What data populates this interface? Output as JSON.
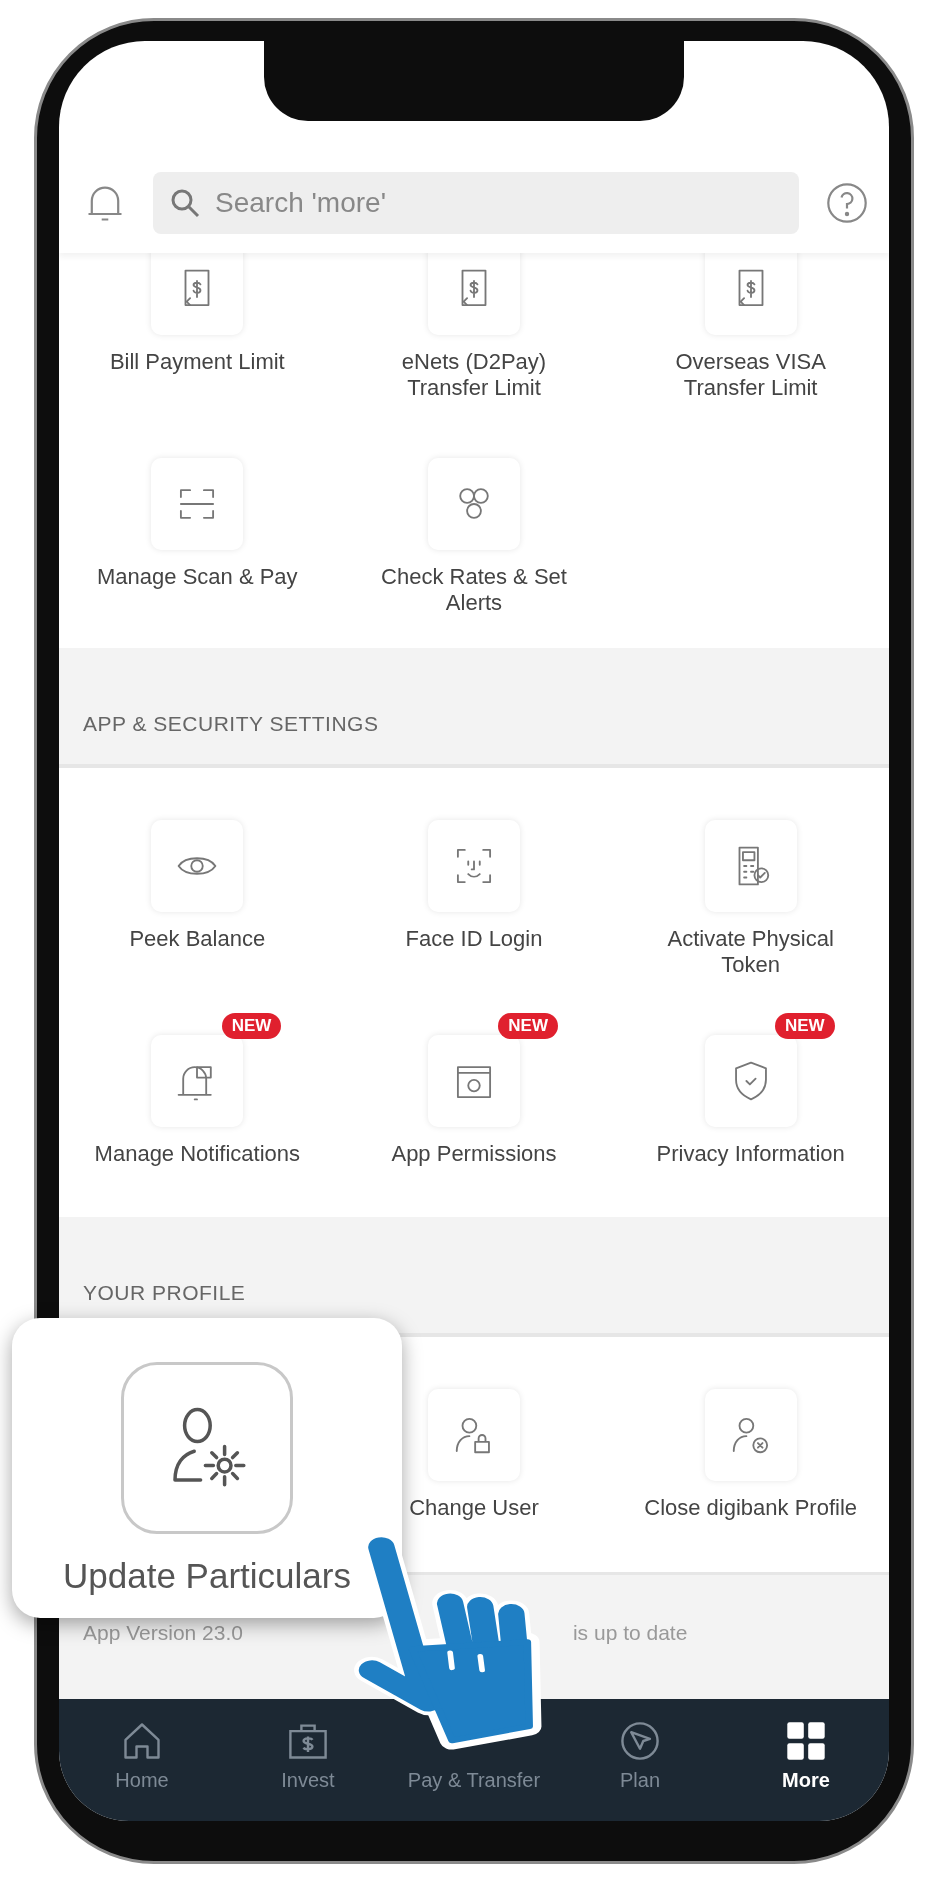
{
  "header": {
    "search": {
      "placeholder": "Search 'more'"
    }
  },
  "sections": [
    {
      "items": [
        {
          "label": "Bill Payment Limit"
        },
        {
          "label": "eNets (D2Pay) Transfer Limit"
        },
        {
          "label": "Overseas VISA Transfer Limit"
        },
        {
          "label": "Manage Scan & Pay"
        },
        {
          "label": "Check Rates & Set Alerts"
        }
      ]
    },
    {
      "title": "APP & SECURITY SETTINGS",
      "items": [
        {
          "label": "Peek Balance"
        },
        {
          "label": "Face ID Login"
        },
        {
          "label": "Activate Physical Token"
        },
        {
          "label": "Manage Notifications",
          "badge": "NEW"
        },
        {
          "label": "App Permissions",
          "badge": "NEW"
        },
        {
          "label": "Privacy Information",
          "badge": "NEW"
        }
      ]
    },
    {
      "title": "YOUR PROFILE",
      "items": [
        {
          "label": "Change User"
        },
        {
          "label": "Close digibank Profile"
        }
      ]
    }
  ],
  "app_version": {
    "left": "App Version 23.0",
    "right": "is up to date"
  },
  "nav": [
    {
      "label": "Home",
      "selected": false
    },
    {
      "label": "Invest",
      "selected": false
    },
    {
      "label": "Pay & Transfer",
      "selected": false
    },
    {
      "label": "Plan",
      "selected": false
    },
    {
      "label": "More",
      "selected": true
    }
  ],
  "callout": {
    "label": "Update Particulars"
  }
}
